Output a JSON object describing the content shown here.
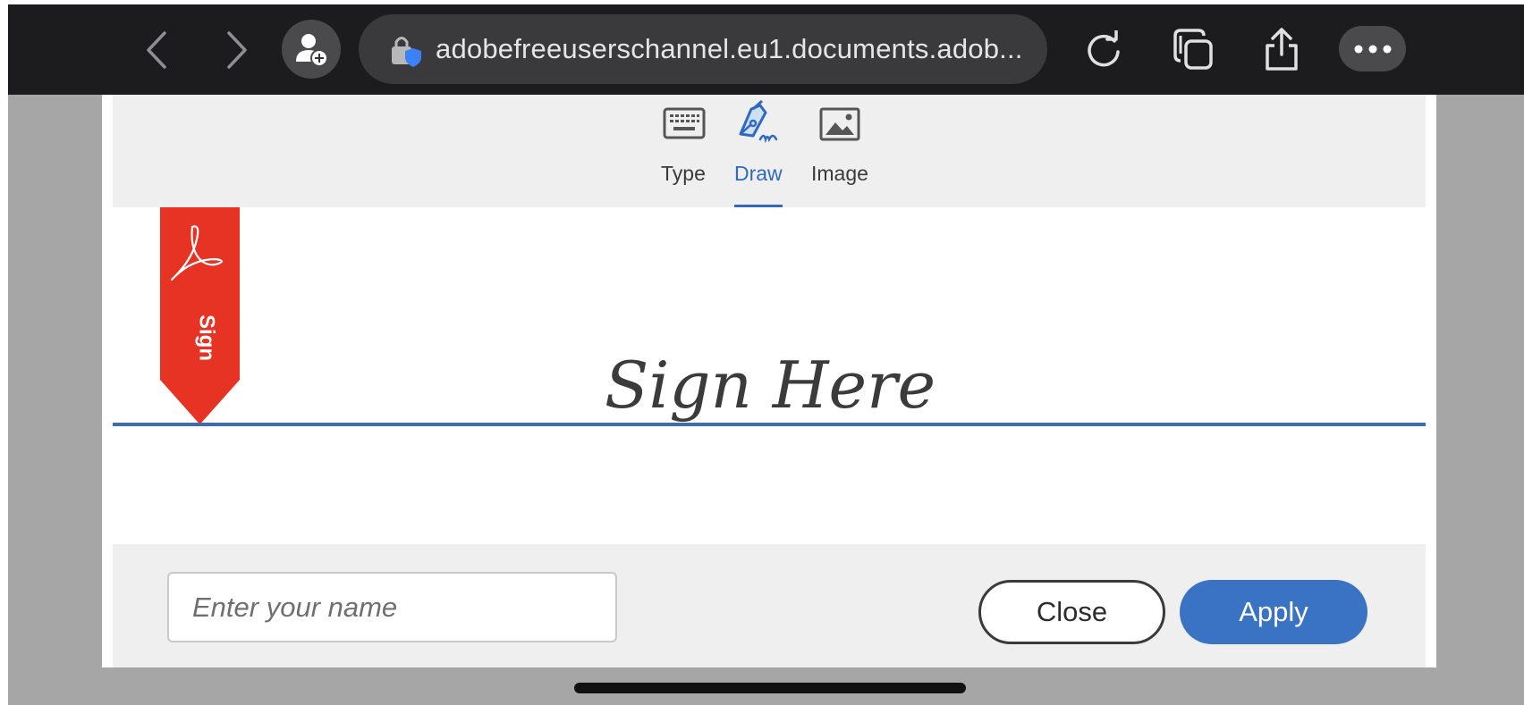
{
  "browser": {
    "url": "adobefreeuserschannel.eu1.documents.adob...",
    "icons": [
      "chevron-left-icon",
      "chevron-right-icon",
      "profile-add-icon",
      "lock-shield-icon",
      "reload-icon",
      "tabs-icon",
      "share-icon",
      "more-icon"
    ]
  },
  "signature_dialog": {
    "tabs": [
      {
        "label": "Type",
        "icon": "keyboard-icon",
        "active": false
      },
      {
        "label": "Draw",
        "icon": "pen-icon",
        "active": true
      },
      {
        "label": "Image",
        "icon": "image-icon",
        "active": false
      }
    ],
    "ribbon_label": "Sign",
    "placeholder_signature": "Sign Here",
    "name_input": {
      "value": "",
      "placeholder": "Enter your name"
    },
    "buttons": {
      "close": "Close",
      "apply": "Apply"
    },
    "colors": {
      "accent": "#2f6ac2",
      "ribbon": "#e63323",
      "apply": "#3a73c4"
    }
  }
}
